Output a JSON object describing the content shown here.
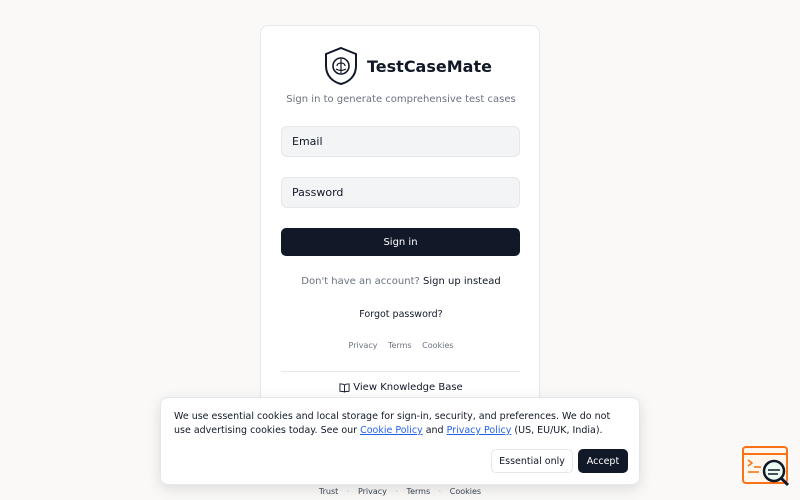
{
  "app": {
    "name": "TestCaseMate",
    "subtitle": "Sign in to generate comprehensive test cases"
  },
  "form": {
    "email_placeholder": "Email",
    "password_placeholder": "Password",
    "signin_label": "Sign in",
    "signup_prompt": "Don't have an account?",
    "signup_link": "Sign up instead",
    "forgot_link": "Forgot password?"
  },
  "card_links": {
    "privacy": "Privacy",
    "terms": "Terms",
    "cookies": "Cookies"
  },
  "knowledge_base": {
    "label": "View Knowledge Base",
    "icon": "book-open-icon"
  },
  "cookie_banner": {
    "text_part1": "We use essential cookies and local storage for sign-in, security, and preferences. We do not use advertising cookies today. See our",
    "cookie_policy_link": "Cookie Policy",
    "and": "and",
    "privacy_policy_link": "Privacy Policy",
    "text_part2": "(US, EU/UK, India).",
    "essential_only_label": "Essential only",
    "accept_label": "Accept"
  },
  "footer": {
    "trust": "Trust",
    "privacy": "Privacy",
    "terms": "Terms",
    "cookies": "Cookies",
    "separator": "·"
  },
  "colors": {
    "primary": "#111827",
    "link": "#2563eb",
    "background": "#faf9f7",
    "widget_accent": "#f97316"
  },
  "icons": {
    "logo": "shield-brain-icon",
    "widget": "chat-search-icon"
  }
}
